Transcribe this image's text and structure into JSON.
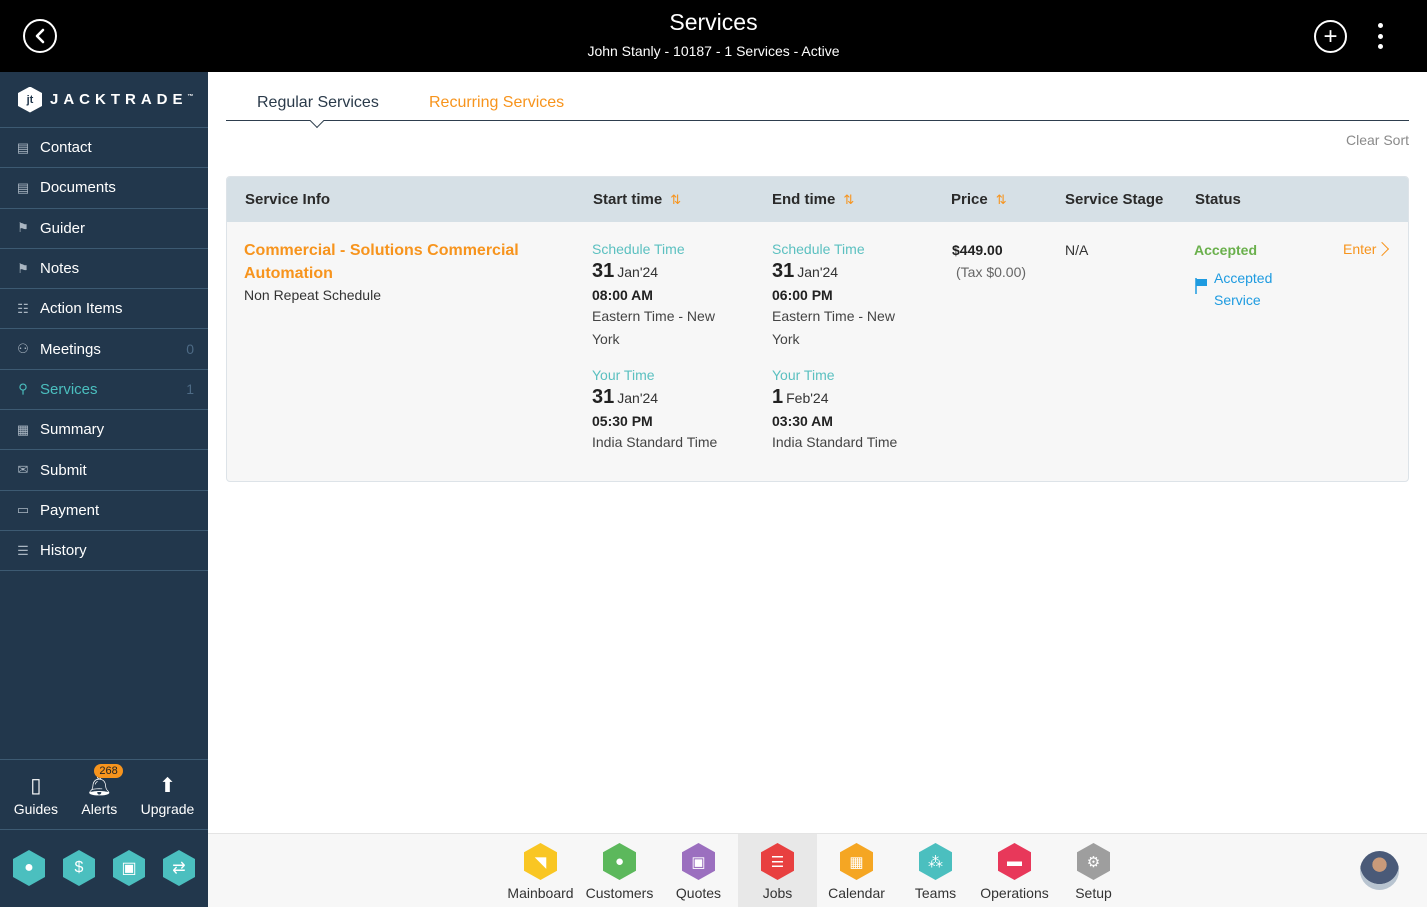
{
  "header": {
    "title": "Services",
    "subtitle": "John Stanly - 10187 - 1 Services - Active",
    "back_icon": "chevron-left-circle-icon",
    "add_icon": "plus-circle-icon",
    "more_icon": "vertical-ellipsis-icon"
  },
  "sidebar": {
    "logo": {
      "text": "JACKTRADE",
      "tm": "™",
      "mark": "jt"
    },
    "items": [
      {
        "label": "Contact",
        "icon": "▤",
        "count": ""
      },
      {
        "label": "Documents",
        "icon": "▤",
        "count": ""
      },
      {
        "label": "Guider",
        "icon": "⚑",
        "count": ""
      },
      {
        "label": "Notes",
        "icon": "⚑",
        "count": ""
      },
      {
        "label": "Action Items",
        "icon": "☷",
        "count": ""
      },
      {
        "label": "Meetings",
        "icon": "⚇",
        "count": "0"
      },
      {
        "label": "Services",
        "icon": "⚲",
        "count": "1",
        "active": true
      },
      {
        "label": "Summary",
        "icon": "▦",
        "count": ""
      },
      {
        "label": "Submit",
        "icon": "✉",
        "count": ""
      },
      {
        "label": "Payment",
        "icon": "▭",
        "count": ""
      },
      {
        "label": "History",
        "icon": "☰",
        "count": ""
      }
    ],
    "tools": [
      {
        "label": "Guides",
        "icon": "▯"
      },
      {
        "label": "Alerts",
        "icon": "🔔︎",
        "badge": "268"
      },
      {
        "label": "Upgrade",
        "icon": "⬆"
      }
    ],
    "quick": [
      {
        "name": "contact",
        "icon": "●"
      },
      {
        "name": "payment",
        "icon": "$"
      },
      {
        "name": "quotes",
        "icon": "▣"
      },
      {
        "name": "workflow",
        "icon": "⇄"
      }
    ]
  },
  "tabs": {
    "regular": "Regular Services",
    "recurring": "Recurring Services",
    "clear_sort": "Clear Sort"
  },
  "table": {
    "headers": {
      "service_info": "Service Info",
      "start_time": "Start time",
      "end_time": "End time",
      "price": "Price",
      "service_stage": "Service Stage",
      "status": "Status"
    },
    "sort_icon": "⇅",
    "rows": [
      {
        "service_name": "Commercial - Solutions Commercial Automation",
        "schedule_type": "Non Repeat Schedule",
        "start": {
          "schedule_label": "Schedule Time",
          "schedule_day": "31",
          "schedule_month": "Jan'24",
          "schedule_time": "08:00 AM",
          "schedule_tz": "Eastern Time - New York",
          "your_label": "Your Time",
          "your_day": "31",
          "your_month": "Jan'24",
          "your_time": "05:30 PM",
          "your_tz": "India Standard Time"
        },
        "end": {
          "schedule_label": "Schedule Time",
          "schedule_day": "31",
          "schedule_month": "Jan'24",
          "schedule_time": "06:00 PM",
          "schedule_tz": "Eastern Time - New York",
          "your_label": "Your Time",
          "your_day": "1",
          "your_month": "Feb'24",
          "your_time": "03:30 AM",
          "your_tz": "India Standard Time"
        },
        "price": "$449.00",
        "tax": "(Tax $0.00)",
        "service_stage": "N/A",
        "status": "Accepted",
        "status_detail": "Accepted Service",
        "action": "Enter"
      }
    ]
  },
  "bottom_nav": {
    "items": [
      {
        "label": "Mainboard",
        "color": "#f9c623",
        "icon": "◥"
      },
      {
        "label": "Customers",
        "color": "#5cb85c",
        "icon": "●"
      },
      {
        "label": "Quotes",
        "color": "#9b6fbf",
        "icon": "▣"
      },
      {
        "label": "Jobs",
        "color": "#e84040",
        "icon": "☰",
        "active": true
      },
      {
        "label": "Calendar",
        "color": "#f5a623",
        "icon": "▦"
      },
      {
        "label": "Teams",
        "color": "#4bbfbf",
        "icon": "⁂"
      },
      {
        "label": "Operations",
        "color": "#e8385a",
        "icon": "▬"
      },
      {
        "label": "Setup",
        "color": "#9e9e9e",
        "icon": "⚙"
      }
    ]
  }
}
